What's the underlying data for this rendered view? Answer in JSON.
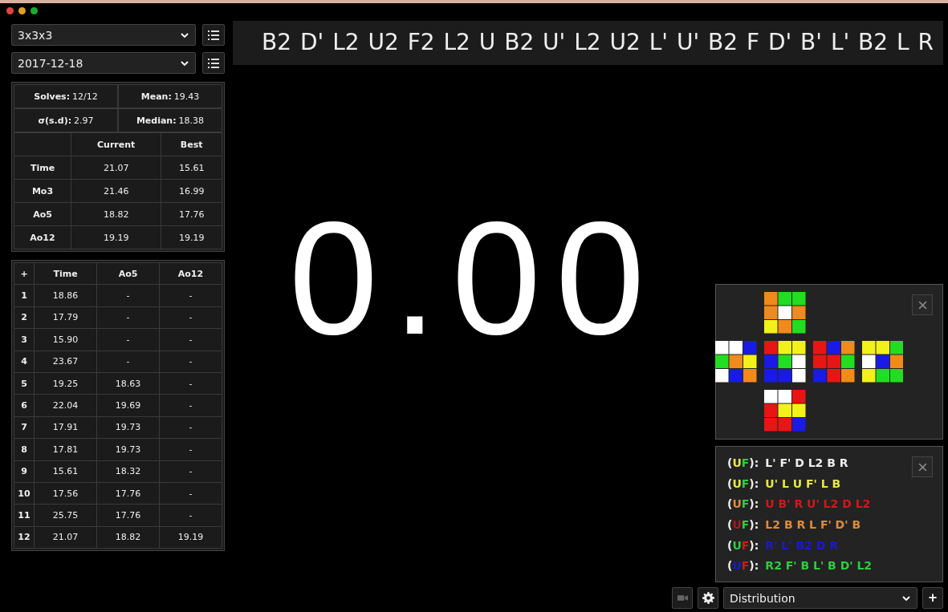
{
  "puzzle_select": {
    "value": "3x3x3"
  },
  "session_select": {
    "value": "2017-12-18"
  },
  "summary": [
    {
      "label": "Solves:",
      "value": "12/12"
    },
    {
      "label": "Mean:",
      "value": "19.43"
    },
    {
      "label": "σ(s.d):",
      "value": "2.97"
    },
    {
      "label": "Median:",
      "value": "18.38"
    }
  ],
  "stats_table": {
    "columns": [
      "Current",
      "Best"
    ],
    "rows": [
      {
        "label": "Time",
        "values": [
          "21.07",
          "15.61"
        ]
      },
      {
        "label": "Mo3",
        "values": [
          "21.46",
          "16.99"
        ]
      },
      {
        "label": "Ao5",
        "values": [
          "18.82",
          "17.76"
        ]
      },
      {
        "label": "Ao12",
        "values": [
          "19.19",
          "19.19"
        ]
      }
    ]
  },
  "times_table": {
    "add_label": "+",
    "columns": [
      "Time",
      "Ao5",
      "Ao12"
    ],
    "rows": [
      {
        "index": "1",
        "values": [
          "18.86",
          "-",
          "-"
        ]
      },
      {
        "index": "2",
        "values": [
          "17.79",
          "-",
          "-"
        ]
      },
      {
        "index": "3",
        "values": [
          "15.90",
          "-",
          "-"
        ]
      },
      {
        "index": "4",
        "values": [
          "23.67",
          "-",
          "-"
        ]
      },
      {
        "index": "5",
        "values": [
          "19.25",
          "18.63",
          "-"
        ]
      },
      {
        "index": "6",
        "values": [
          "22.04",
          "19.69",
          "-"
        ]
      },
      {
        "index": "7",
        "values": [
          "17.91",
          "19.73",
          "-"
        ]
      },
      {
        "index": "8",
        "values": [
          "17.81",
          "19.73",
          "-"
        ]
      },
      {
        "index": "9",
        "values": [
          "15.61",
          "18.32",
          "-"
        ]
      },
      {
        "index": "10",
        "values": [
          "17.56",
          "17.76",
          "-"
        ]
      },
      {
        "index": "11",
        "values": [
          "25.75",
          "17.76",
          "-"
        ]
      },
      {
        "index": "12",
        "values": [
          "21.07",
          "18.82",
          "19.19"
        ]
      }
    ]
  },
  "scramble": "B2 D' L2 U2 F2 L2 U B2 U' L2 U2 L' U' B2 F D' B' L' B2 L R",
  "timer": "0.00",
  "cube_net": {
    "faces": [
      {
        "stickers": [
          {
            "color": "#f08a1c"
          },
          {
            "color": "#22dd22"
          },
          {
            "color": "#22dd22"
          },
          {
            "color": "#f08a1c"
          },
          {
            "color": "#ffffff"
          },
          {
            "color": "#f08a1c"
          },
          {
            "color": "#f2f21a"
          },
          {
            "color": "#f08a1c"
          },
          {
            "color": "#22dd22"
          }
        ]
      },
      {
        "stickers": [
          {
            "color": "#ffffff"
          },
          {
            "color": "#ffffff"
          },
          {
            "color": "#1a1ae6"
          },
          {
            "color": "#22dd22"
          },
          {
            "color": "#f08a1c"
          },
          {
            "color": "#f2f21a"
          },
          {
            "color": "#ffffff"
          },
          {
            "color": "#1a1ae6"
          },
          {
            "color": "#f08a1c"
          }
        ]
      },
      {
        "stickers": [
          {
            "color": "#e81515"
          },
          {
            "color": "#f2f21a"
          },
          {
            "color": "#f2f21a"
          },
          {
            "color": "#1a1ae6"
          },
          {
            "color": "#22dd22"
          },
          {
            "color": "#ffffff"
          },
          {
            "color": "#1a1ae6"
          },
          {
            "color": "#1a1ae6"
          },
          {
            "color": "#ffffff"
          }
        ]
      },
      {
        "stickers": [
          {
            "color": "#e81515"
          },
          {
            "color": "#1a1ae6"
          },
          {
            "color": "#f08a1c"
          },
          {
            "color": "#e81515"
          },
          {
            "color": "#e81515"
          },
          {
            "color": "#22dd22"
          },
          {
            "color": "#1a1ae6"
          },
          {
            "color": "#e81515"
          },
          {
            "color": "#f08a1c"
          }
        ]
      },
      {
        "stickers": [
          {
            "color": "#f2f21a"
          },
          {
            "color": "#f2f21a"
          },
          {
            "color": "#22dd22"
          },
          {
            "color": "#ffffff"
          },
          {
            "color": "#1a1ae6"
          },
          {
            "color": "#f08a1c"
          },
          {
            "color": "#f2f21a"
          },
          {
            "color": "#22dd22"
          },
          {
            "color": "#22dd22"
          }
        ]
      },
      {
        "stickers": [
          {
            "color": "#ffffff"
          },
          {
            "color": "#ffffff"
          },
          {
            "color": "#e81515"
          },
          {
            "color": "#e81515"
          },
          {
            "color": "#f2f21a"
          },
          {
            "color": "#f2f21a"
          },
          {
            "color": "#e81515"
          },
          {
            "color": "#e81515"
          },
          {
            "color": "#1a1ae6"
          }
        ]
      }
    ]
  },
  "cross_solutions": [
    {
      "parts": [
        {
          "text": "(",
          "color": "#eeeeee"
        },
        {
          "text": "U",
          "color": "#e6e64a"
        },
        {
          "text": "F",
          "color": "#2ecc40"
        },
        {
          "text": "):",
          "color": "#eeeeee"
        }
      ],
      "moves": "L' F' D L2 B R",
      "color": "#eeeeee"
    },
    {
      "parts": [
        {
          "text": "(",
          "color": "#eeeeee"
        },
        {
          "text": "U",
          "color": "#e6e64a"
        },
        {
          "text": "F",
          "color": "#2ecc40"
        },
        {
          "text": "):",
          "color": "#eeeeee"
        }
      ],
      "moves": "U' L U F' L B",
      "color": "#e6e64a"
    },
    {
      "parts": [
        {
          "text": "(",
          "color": "#eeeeee"
        },
        {
          "text": "U",
          "color": "#e08a3a"
        },
        {
          "text": "F",
          "color": "#2ecc40"
        },
        {
          "text": "):",
          "color": "#eeeeee"
        }
      ],
      "moves": "U B' R U' L2 D L2",
      "color": "#cc1a1a"
    },
    {
      "parts": [
        {
          "text": "(",
          "color": "#eeeeee"
        },
        {
          "text": "U",
          "color": "#b01818"
        },
        {
          "text": "F",
          "color": "#2ecc40"
        },
        {
          "text": "):",
          "color": "#eeeeee"
        }
      ],
      "moves": "L2 B R L F' D' B",
      "color": "#e08a3a"
    },
    {
      "parts": [
        {
          "text": "(",
          "color": "#eeeeee"
        },
        {
          "text": "U",
          "color": "#2ecc40"
        },
        {
          "text": "F",
          "color": "#cc1a1a"
        },
        {
          "text": "):",
          "color": "#eeeeee"
        }
      ],
      "moves": "R' L' B2 D R",
      "color": "#1a1acc"
    },
    {
      "parts": [
        {
          "text": "(",
          "color": "#eeeeee"
        },
        {
          "text": "U",
          "color": "#1a1acc"
        },
        {
          "text": "F",
          "color": "#cc1a1a"
        },
        {
          "text": "):",
          "color": "#eeeeee"
        }
      ],
      "moves": "R2 F' B L' B D' L2",
      "color": "#2ecc40"
    }
  ],
  "tool_select": {
    "value": "Distribution"
  },
  "add_tool_label": "+"
}
